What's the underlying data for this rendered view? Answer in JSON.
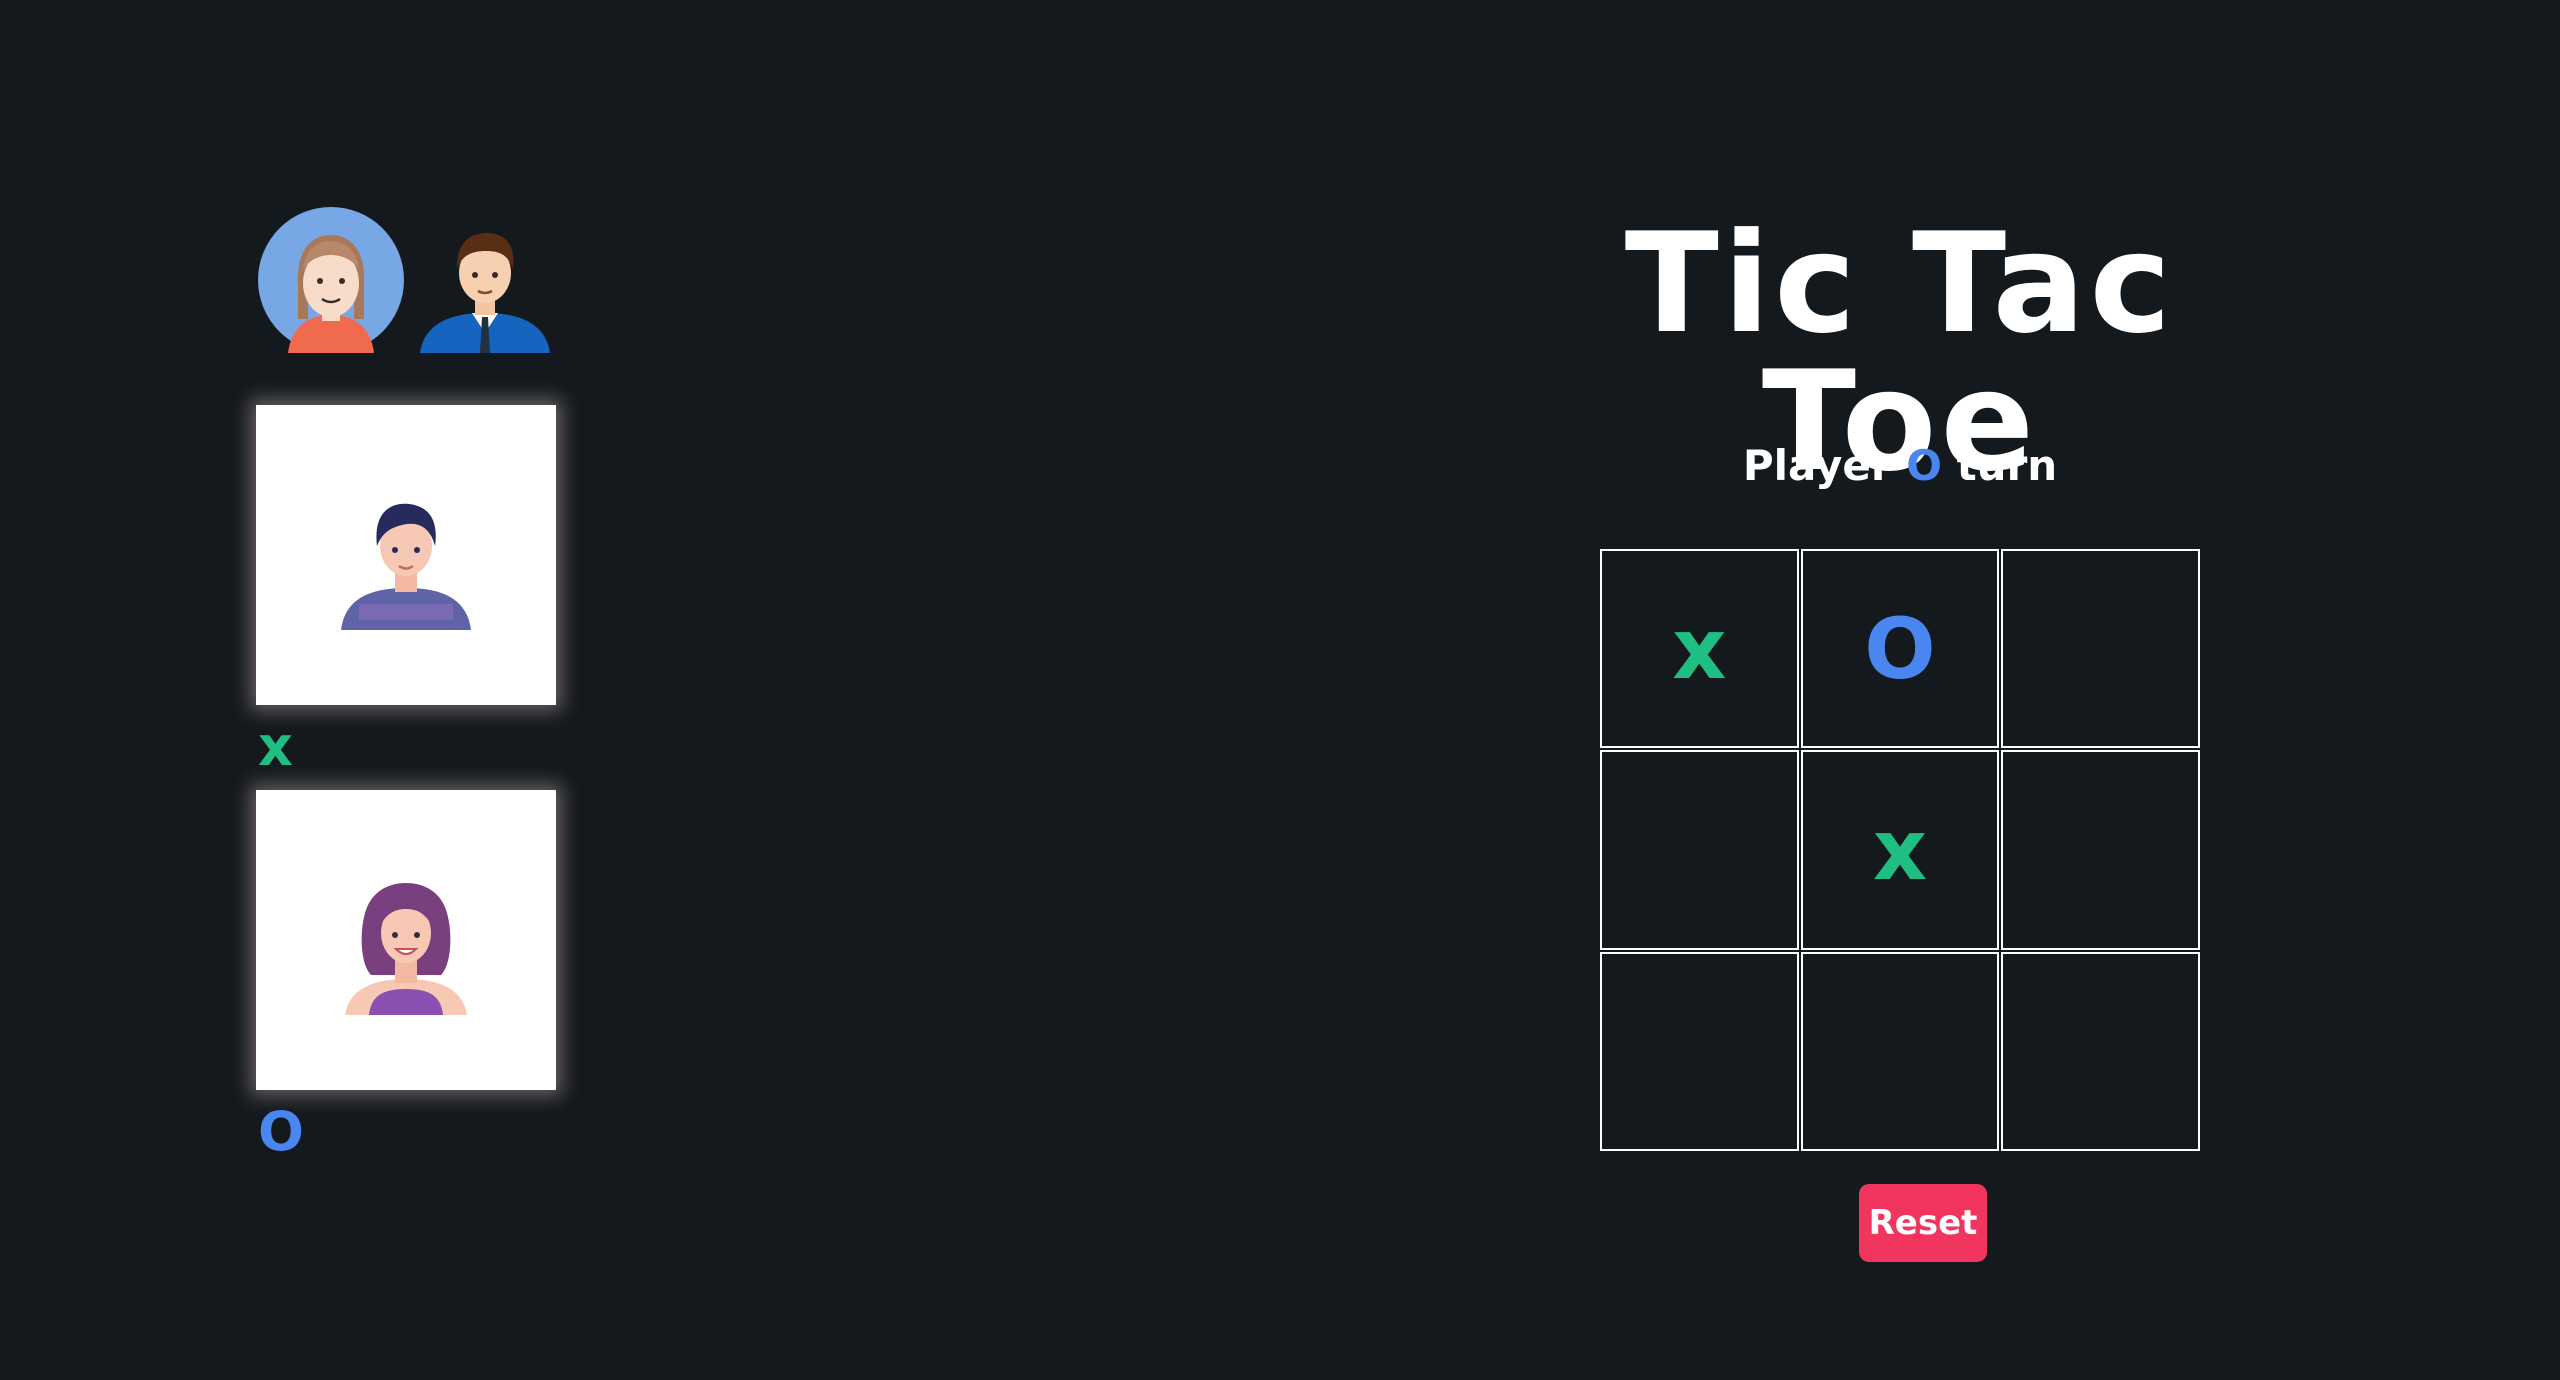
{
  "title": "Tic Tac Toe",
  "status": {
    "prefix": "Player",
    "current_mark": "O",
    "suffix": "turn"
  },
  "avatar_picker": [
    {
      "icon": "woman-avatar-icon"
    },
    {
      "icon": "businessman-avatar-icon"
    }
  ],
  "players": [
    {
      "mark": "x",
      "avatar": "young-man-avatar-icon"
    },
    {
      "mark": "O",
      "avatar": "young-woman-avatar-icon"
    }
  ],
  "board": [
    [
      "x",
      "O",
      ""
    ],
    [
      "",
      "x",
      ""
    ],
    [
      "",
      "",
      ""
    ]
  ],
  "reset_label": "Reset",
  "colors": {
    "background": "#14191d",
    "x_mark": "#1fbf84",
    "o_mark": "#4a86f0",
    "reset_button": "#f2355f"
  }
}
